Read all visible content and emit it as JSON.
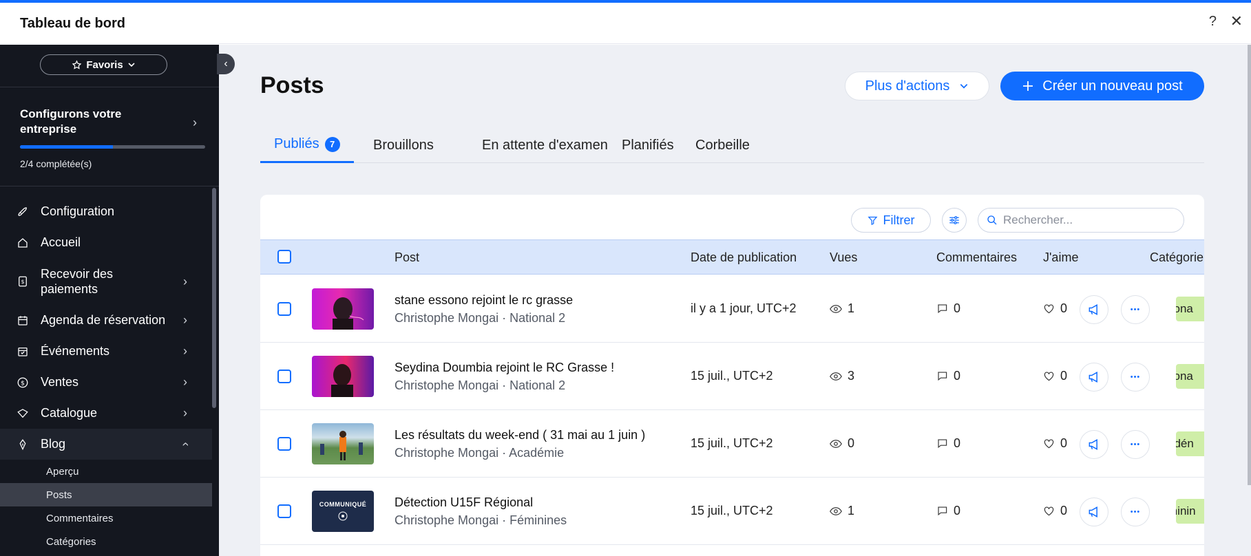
{
  "topbar": {
    "title": "Tableau de bord",
    "help": "?",
    "close": "✕"
  },
  "sidebar": {
    "favorites_label": "Favoris",
    "setup": {
      "title": "Configurons votre entreprise",
      "progress": "2/4 complétée(s)",
      "progress_fraction": 0.5
    },
    "items": [
      {
        "label": "Configuration",
        "icon": "rocket-icon",
        "chevron": false
      },
      {
        "label": "Accueil",
        "icon": "home-icon",
        "chevron": false
      },
      {
        "label": "Recevoir des paiements",
        "icon": "payment-icon",
        "chevron": true
      },
      {
        "label": "Agenda de réservation",
        "icon": "calendar-icon",
        "chevron": true
      },
      {
        "label": "Événements",
        "icon": "event-icon",
        "chevron": true
      },
      {
        "label": "Ventes",
        "icon": "dollar-icon",
        "chevron": true
      },
      {
        "label": "Catalogue",
        "icon": "catalog-icon",
        "chevron": true
      },
      {
        "label": "Blog",
        "icon": "pen-icon",
        "chevron": true
      }
    ],
    "blog_sub": [
      "Aperçu",
      "Posts",
      "Commentaires",
      "Catégories"
    ]
  },
  "main": {
    "title": "Posts",
    "more_actions": "Plus d'actions",
    "create": "Créer un nouveau post",
    "tabs": [
      {
        "label": "Publiés",
        "badge": "7"
      },
      {
        "label": "Brouillons"
      },
      {
        "label": "En attente d'examen"
      },
      {
        "label": "Planifiés"
      },
      {
        "label": "Corbeille"
      }
    ],
    "filter": "Filtrer",
    "search_placeholder": "Rechercher...",
    "columns": [
      "Post",
      "Date de publication",
      "Vues",
      "Commentaires",
      "J'aime",
      "Catégorie"
    ],
    "rows": [
      {
        "title": "stane essono rejoint le rc grasse",
        "author": "Christophe Mongai",
        "category": "National 2",
        "date": "il y a 1 jour, UTC+2",
        "views": "1",
        "comments": "0",
        "likes": "0",
        "cat_tag": "tiona"
      },
      {
        "title": "Seydina Doumbia rejoint le RC Grasse !",
        "author": "Christophe Mongai",
        "category": "National 2",
        "date": "15 juil., UTC+2",
        "views": "3",
        "comments": "0",
        "likes": "0",
        "cat_tag": "tiona"
      },
      {
        "title": "Les résultats du week-end ( 31 mai au 1 juin )",
        "author": "Christophe Mongai",
        "category": "Académie",
        "date": "15 juil., UTC+2",
        "views": "0",
        "comments": "0",
        "likes": "0",
        "cat_tag": "adén"
      },
      {
        "title": "Détection U15F Régional",
        "author": "Christophe Mongai",
        "category": "Féminines",
        "date": "15 juil., UTC+2",
        "views": "1",
        "comments": "0",
        "likes": "0",
        "cat_tag": "minin"
      }
    ],
    "thumb4_text": "COMMUNIQUÉ",
    "separator": "·",
    "more_dots": "•••"
  }
}
